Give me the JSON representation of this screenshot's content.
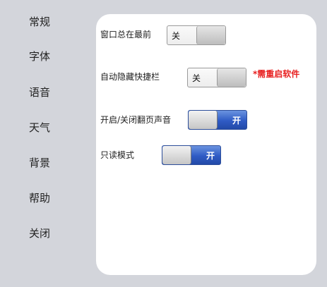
{
  "sidebar": {
    "items": [
      {
        "label": "常规"
      },
      {
        "label": "字体"
      },
      {
        "label": "语音"
      },
      {
        "label": "天气"
      },
      {
        "label": "背景"
      },
      {
        "label": "帮助"
      },
      {
        "label": "关闭"
      }
    ]
  },
  "settings": {
    "always_on_top": {
      "label": "窗口总在最前",
      "state": "off",
      "state_text": "关"
    },
    "auto_hide_shortcut_bar": {
      "label": "自动隐藏快捷栏",
      "state": "off",
      "state_text": "关",
      "note": "*需重启软件"
    },
    "page_turn_sound": {
      "label": "开启/关闭翻页声音",
      "state": "on",
      "state_text": "开"
    },
    "read_only_mode": {
      "label": "只读模式",
      "state": "on",
      "state_text": "开"
    }
  },
  "colors": {
    "background": "#d3d5db",
    "panel": "#ffffff",
    "toggle_on": "#2f5bc4",
    "note": "#e82020"
  }
}
